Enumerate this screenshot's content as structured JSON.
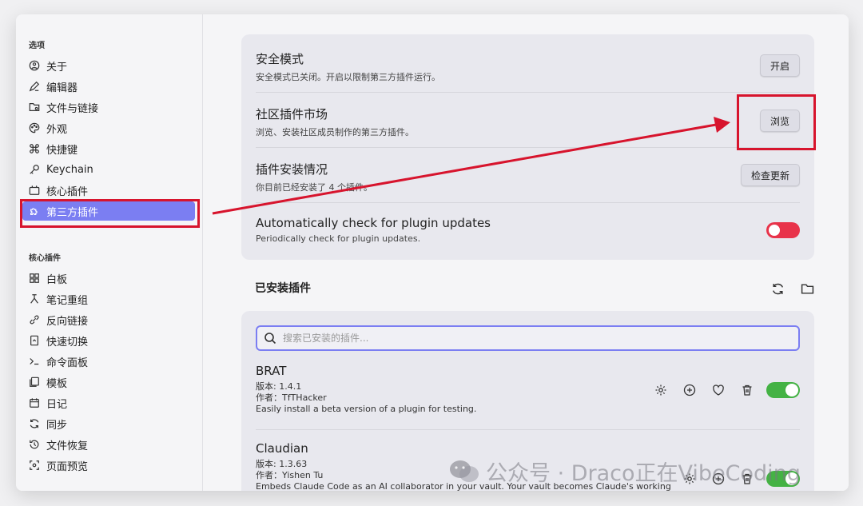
{
  "sidebar": {
    "section1_title": "选项",
    "items1": [
      {
        "label": "关于",
        "icon": "info-circle-icon"
      },
      {
        "label": "编辑器",
        "icon": "pencil-icon"
      },
      {
        "label": "文件与链接",
        "icon": "folder-link-icon"
      },
      {
        "label": "外观",
        "icon": "palette-icon"
      },
      {
        "label": "快捷键",
        "icon": "command-icon"
      },
      {
        "label": "Keychain",
        "icon": "key-icon"
      },
      {
        "label": "核心插件",
        "icon": "plug-icon"
      },
      {
        "label": "第三方插件",
        "icon": "puzzle-icon",
        "active": true
      }
    ],
    "section2_title": "核心插件",
    "items2": [
      {
        "label": "白板",
        "icon": "grid-icon"
      },
      {
        "label": "笔记重组",
        "icon": "merge-icon"
      },
      {
        "label": "反向链接",
        "icon": "backlink-icon"
      },
      {
        "label": "快速切换",
        "icon": "switch-icon"
      },
      {
        "label": "命令面板",
        "icon": "terminal-icon"
      },
      {
        "label": "模板",
        "icon": "template-icon"
      },
      {
        "label": "日记",
        "icon": "calendar-icon"
      },
      {
        "label": "同步",
        "icon": "sync-icon"
      },
      {
        "label": "文件恢复",
        "icon": "history-icon"
      },
      {
        "label": "页面预览",
        "icon": "preview-icon"
      }
    ]
  },
  "settings": {
    "safe_mode": {
      "title": "安全模式",
      "desc": "安全模式已关闭。开启以限制第三方插件运行。",
      "button": "开启"
    },
    "market": {
      "title": "社区插件市场",
      "desc": "浏览、安装社区成员制作的第三方插件。",
      "button": "浏览"
    },
    "installed_status": {
      "title": "插件安装情况",
      "desc": "你目前已经安装了 4 个插件。",
      "button": "检查更新"
    },
    "auto_check": {
      "title": "Automatically check for plugin updates",
      "desc": "Periodically check for plugin updates.",
      "enabled": false
    }
  },
  "installed": {
    "heading": "已安装插件",
    "search_placeholder": "搜索已安装的插件...",
    "plugins": [
      {
        "name": "BRAT",
        "version": "版本: 1.4.1",
        "author": "作者：TfTHacker",
        "desc": "Easily install a beta version of a plugin for testing.",
        "enabled": true
      },
      {
        "name": "Claudian",
        "version": "版本: 1.3.63",
        "author": "作者：Yishen Tu",
        "desc": "Embeds Claude Code as an AI collaborator in your vault. Your vault becomes Claude's working",
        "enabled": true
      }
    ]
  },
  "watermark": "公众号 · Draco正在VibeCoding",
  "colors": {
    "accent": "#7b7ef2",
    "annotation_red": "#d7142d",
    "toggle_on": "#44b244",
    "toggle_off_red": "#e8334a"
  }
}
